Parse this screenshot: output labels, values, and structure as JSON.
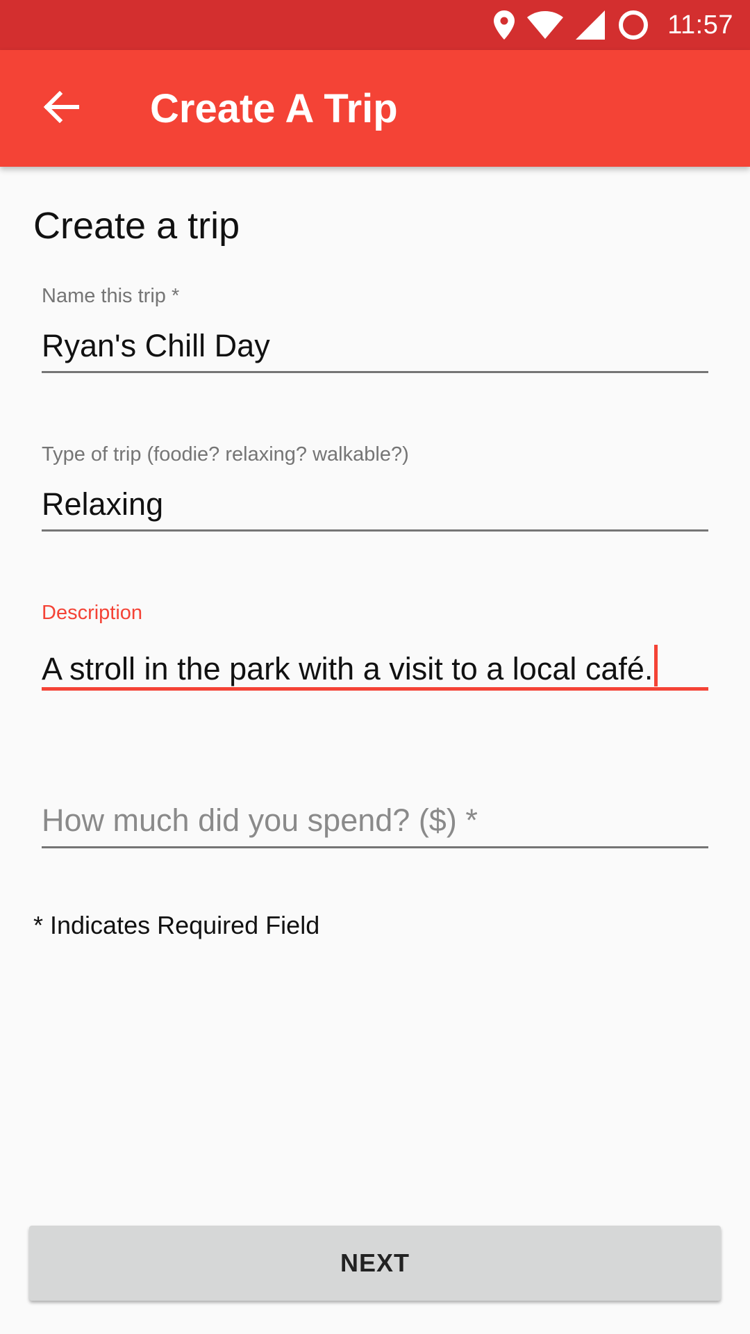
{
  "status_bar": {
    "time": "11:57",
    "icons": [
      "location-icon",
      "wifi-icon",
      "signal-icon",
      "sync-icon"
    ]
  },
  "app_bar": {
    "back_icon": "arrow-back-icon",
    "title": "Create A Trip",
    "color": "#f44336"
  },
  "form": {
    "heading": "Create a trip",
    "fields": [
      {
        "label": "Name this trip *",
        "value": "Ryan's Chill Day",
        "focused": false
      },
      {
        "label": "Type of trip (foodie? relaxing? walkable?)",
        "value": "Relaxing",
        "focused": false
      },
      {
        "label": "Description",
        "value": "A stroll in the park with a visit to a local café.",
        "focused": true
      },
      {
        "label": "",
        "value": "",
        "placeholder": "How much did you spend? ($) *",
        "focused": false
      }
    ],
    "required_note": "* Indicates Required Field",
    "next_label": "NEXT"
  },
  "colors": {
    "status_bar": "#d32f2f",
    "accent": "#f44336",
    "button_bg": "#d6d7d7"
  }
}
